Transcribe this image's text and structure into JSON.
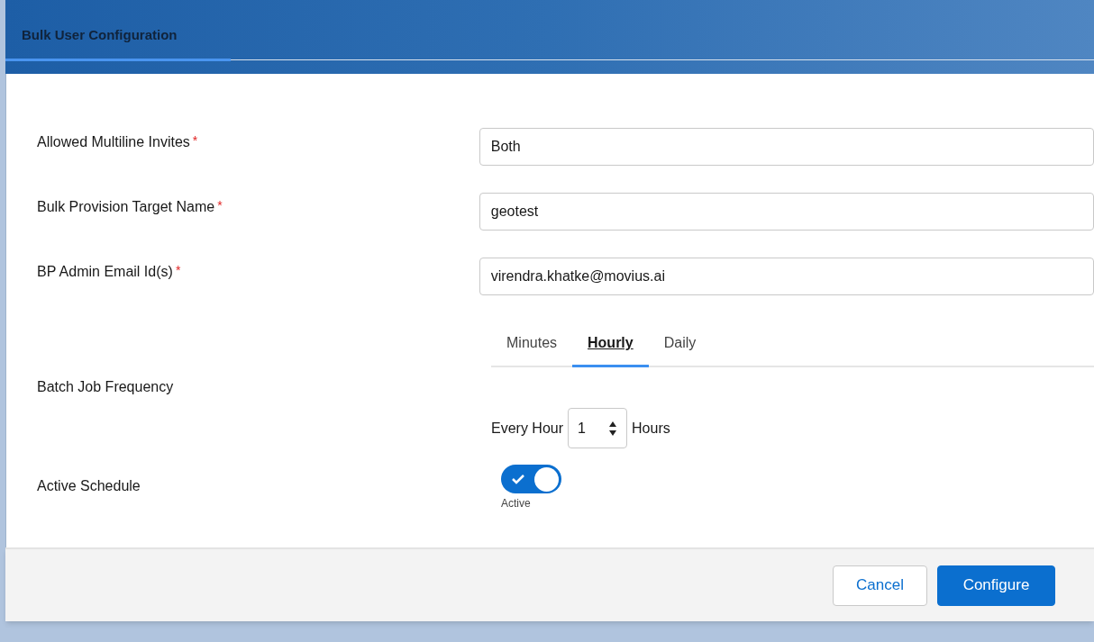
{
  "header": {
    "title": "Bulk User Configuration"
  },
  "fields": [
    {
      "kind": "text",
      "label": "Allowed Multiline Invites",
      "required_mark": "*",
      "value": "Both"
    },
    {
      "kind": "text",
      "label": "Bulk Provision Target Name",
      "required_mark": "*",
      "value": "geotest"
    },
    {
      "kind": "text",
      "label": "BP Admin Email Id(s)",
      "required_mark": "*",
      "value": "virendra.khatke@movius.ai"
    }
  ],
  "frequency": {
    "label": "Batch Job Frequency",
    "tabs": [
      {
        "label": "Minutes",
        "selected": false
      },
      {
        "label": "Hourly",
        "selected": true
      },
      {
        "label": "Daily",
        "selected": false
      }
    ],
    "prefix": "Every Hour",
    "value": "1",
    "suffix": "Hours"
  },
  "schedule": {
    "label": "Active Schedule",
    "on": true,
    "state_label": "Active"
  },
  "buttons": [
    {
      "kind": "secondary",
      "label": "Cancel"
    },
    {
      "kind": "primary",
      "label": "Configure"
    }
  ]
}
